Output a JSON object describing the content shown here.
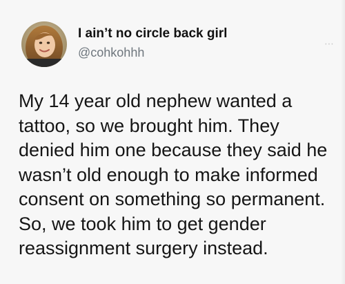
{
  "author": {
    "display_name": "I ain’t no circle back girl",
    "handle": "@cohkohhh",
    "avatar_icon": "profile-photo-avatar"
  },
  "tweet": {
    "lines": [
      "My 14 year old nephew wanted a",
      "tattoo, so we brought him. They",
      "denied him one because they said he",
      "wasn’t old enough to make informed",
      "consent on something so permanent.",
      "So, we took him to get gender",
      "reassignment surgery instead."
    ]
  },
  "colors": {
    "background": "#f7f7f7",
    "text": "#151515",
    "handle": "#6e767d"
  }
}
